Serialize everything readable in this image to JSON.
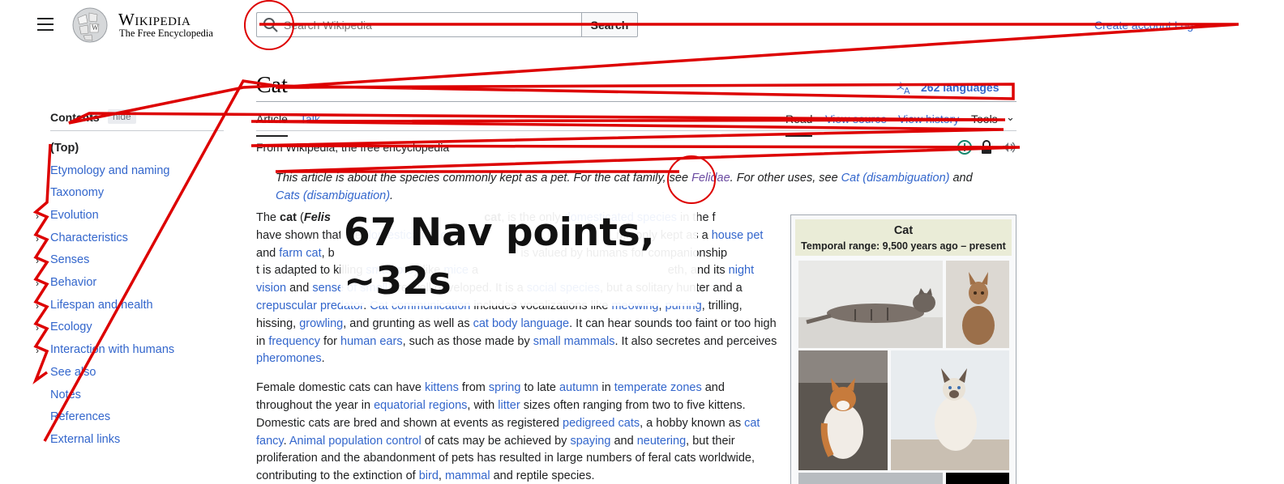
{
  "header": {
    "wordmark": "Wikipedia",
    "tagline": "The Free Encyclopedia",
    "search_placeholder": "Search Wikipedia",
    "search_button": "Search",
    "account_link": "Create account  Log"
  },
  "page": {
    "title": "Cat",
    "languages": "262 languages",
    "tabs": {
      "article": "Article",
      "talk": "Talk",
      "read": "Read",
      "view_source": "View source",
      "history": "View history",
      "tools": "Tools"
    },
    "from": "From Wikipedia, the free encyclopedia"
  },
  "toc": {
    "heading": "Contents",
    "hide": "hide",
    "items": [
      "(Top)",
      "Etymology and naming",
      "Taxonomy",
      "Evolution",
      "Characteristics",
      "Senses",
      "Behavior",
      "Lifespan and health",
      "Ecology",
      "Interaction with humans",
      "See also",
      "Notes",
      "References",
      "External links"
    ]
  },
  "hatnote": {
    "t1": "This article is about the species commonly kept as a pet. For the cat family, see ",
    "l1": "Felidae",
    "t2": ". For other uses, see ",
    "l2": "Cat (disambiguation)",
    "t3": " and ",
    "l3": "Cats (disambiguation)",
    "t4": "."
  },
  "body": {
    "p1": [
      {
        "t": "The "
      },
      {
        "t": "cat",
        "b": true
      },
      {
        "t": " ("
      },
      {
        "t": "Felis",
        "b": true,
        "i": true
      },
      {
        "t": "                                               "
      },
      {
        "t": "cat",
        "b": true
      },
      {
        "t": ", is the only "
      },
      {
        "t": "domesticated",
        "l": true
      },
      {
        "t": " "
      },
      {
        "t": "species",
        "l": true
      },
      {
        "t": " in the f"
      },
      {
        "t": "                                                      have shown that the "
      },
      {
        "t": "domestication c",
        "l": true
      },
      {
        "t": "                                                    mmonly kept as a "
      },
      {
        "t": "house pet",
        "l": true
      },
      {
        "t": " and "
      },
      {
        "t": "farm cat",
        "l": true
      },
      {
        "t": ", b"
      },
      {
        "t": "                                                         is valued by humans for companionship"
      },
      {
        "t": "                                                 t is adapted to killing "
      },
      {
        "t": "small prey",
        "l": true
      },
      {
        "t": " like "
      },
      {
        "t": "mice",
        "l": true
      },
      {
        "t": " a"
      },
      {
        "t": "                                                          eth, and its "
      },
      {
        "t": "night vision",
        "l": true
      },
      {
        "t": " and "
      },
      {
        "t": "sense of smell",
        "l": true
      },
      {
        "t": " are well developed. It is a "
      },
      {
        "t": "social species",
        "l": true
      },
      {
        "t": ", but a solitary hunter and a "
      },
      {
        "t": "crepuscular predator",
        "l": true
      },
      {
        "t": ". "
      },
      {
        "t": "Cat communication",
        "l": true
      },
      {
        "t": " includes vocalizations like "
      },
      {
        "t": "meowing",
        "l": true
      },
      {
        "t": ", "
      },
      {
        "t": "purring",
        "l": true
      },
      {
        "t": ", trilling, hissing, "
      },
      {
        "t": "growling",
        "l": true
      },
      {
        "t": ", and grunting as well as "
      },
      {
        "t": "cat body language",
        "l": true
      },
      {
        "t": ". It can hear sounds too faint or too high in "
      },
      {
        "t": "frequency",
        "l": true
      },
      {
        "t": " for "
      },
      {
        "t": "human ears",
        "l": true
      },
      {
        "t": ", such as those made by "
      },
      {
        "t": "small mammals",
        "l": true
      },
      {
        "t": ". It also secretes and perceives "
      },
      {
        "t": "pheromones",
        "l": true
      },
      {
        "t": "."
      }
    ],
    "p2": [
      {
        "t": "Female domestic cats can have "
      },
      {
        "t": "kittens",
        "l": true
      },
      {
        "t": " from "
      },
      {
        "t": "spring",
        "l": true
      },
      {
        "t": " to late "
      },
      {
        "t": "autumn",
        "l": true
      },
      {
        "t": " in "
      },
      {
        "t": "temperate zones",
        "l": true
      },
      {
        "t": " and throughout the year in "
      },
      {
        "t": "equatorial regions",
        "l": true
      },
      {
        "t": ", with "
      },
      {
        "t": "litter",
        "l": true
      },
      {
        "t": " sizes often ranging from two to five kittens. Domestic cats are bred and shown at events as registered "
      },
      {
        "t": "pedigreed cats",
        "l": true
      },
      {
        "t": ", a hobby known as "
      },
      {
        "t": "cat fancy",
        "l": true
      },
      {
        "t": ". "
      },
      {
        "t": "Animal population control",
        "l": true
      },
      {
        "t": " of cats may be achieved by "
      },
      {
        "t": "spaying",
        "l": true
      },
      {
        "t": " and "
      },
      {
        "t": "neutering",
        "l": true
      },
      {
        "t": ", but their proliferation and the abandonment of pets has resulted in large numbers of feral cats worldwide, contributing to the extinction of "
      },
      {
        "t": "bird",
        "l": true
      },
      {
        "t": ", "
      },
      {
        "t": "mammal",
        "l": true
      },
      {
        "t": " and reptile species."
      }
    ]
  },
  "infobox": {
    "title": "Cat",
    "range": "Temporal range: 9,500 years ago – present"
  },
  "overlay": {
    "caption": "67 Nav points, ~32s",
    "stroke_color": "#dd0000"
  }
}
